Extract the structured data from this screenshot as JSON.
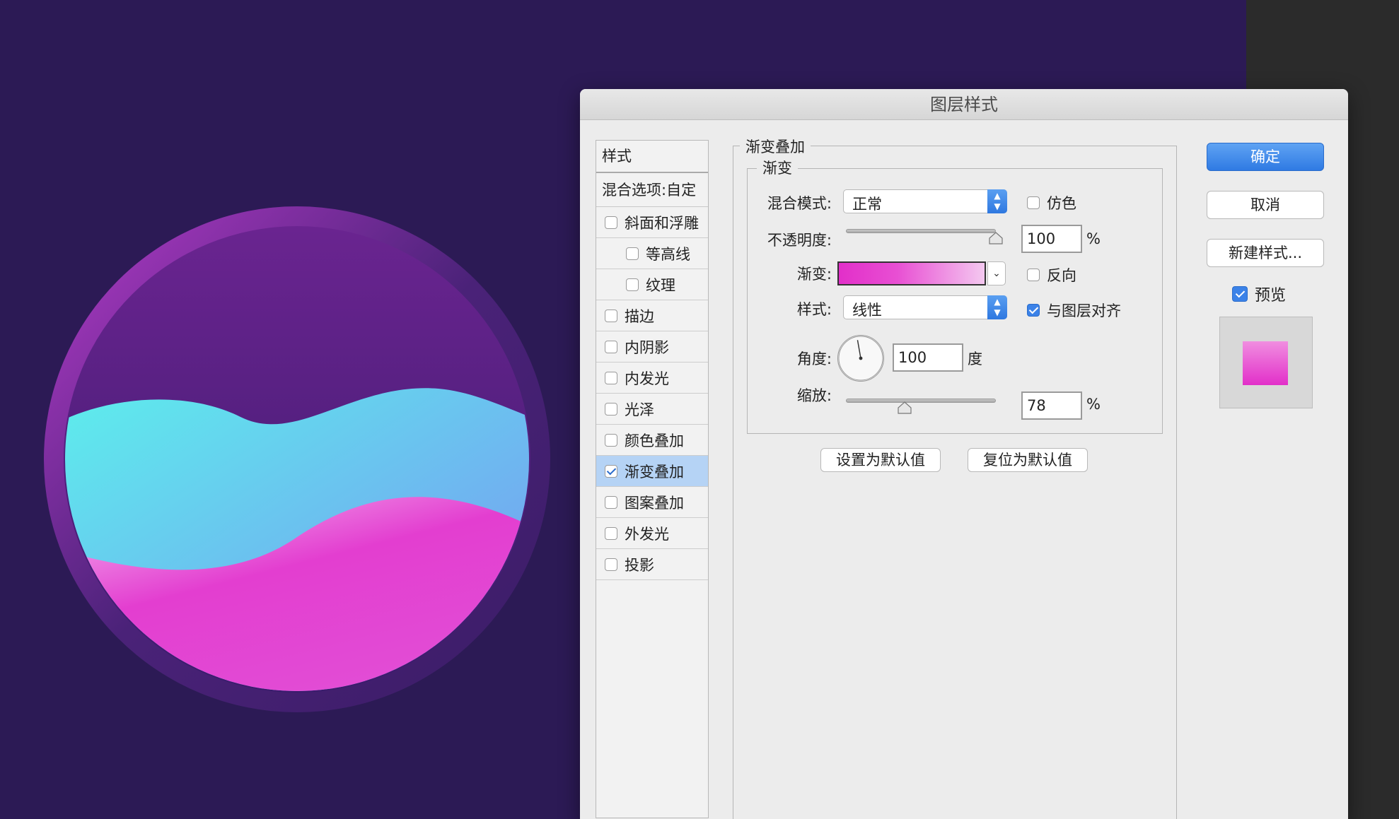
{
  "dialog": {
    "title": "图层样式",
    "ok_label": "确定",
    "cancel_label": "取消",
    "new_style_label": "新建样式...",
    "preview_label": "预览",
    "preview_checked": true
  },
  "styles_list": {
    "header": "样式",
    "blend_options": "混合选项:自定",
    "items": [
      {
        "label": "斜面和浮雕",
        "checked": false,
        "indent": false
      },
      {
        "label": "等高线",
        "checked": false,
        "indent": true
      },
      {
        "label": "纹理",
        "checked": false,
        "indent": true
      },
      {
        "label": "描边",
        "checked": false,
        "indent": false
      },
      {
        "label": "内阴影",
        "checked": false,
        "indent": false
      },
      {
        "label": "内发光",
        "checked": false,
        "indent": false
      },
      {
        "label": "光泽",
        "checked": false,
        "indent": false
      },
      {
        "label": "颜色叠加",
        "checked": false,
        "indent": false
      },
      {
        "label": "渐变叠加",
        "checked": true,
        "indent": false,
        "active": true
      },
      {
        "label": "图案叠加",
        "checked": false,
        "indent": false
      },
      {
        "label": "外发光",
        "checked": false,
        "indent": false
      },
      {
        "label": "投影",
        "checked": false,
        "indent": false
      }
    ]
  },
  "gradient_overlay": {
    "section_title": "渐变叠加",
    "group_title": "渐变",
    "blend_mode_label": "混合模式:",
    "blend_mode_value": "正常",
    "dither_label": "仿色",
    "dither_checked": false,
    "opacity_label": "不透明度:",
    "opacity_value": "100",
    "opacity_unit": "%",
    "opacity_fraction": 1.0,
    "gradient_label": "渐变:",
    "reverse_label": "反向",
    "reverse_checked": false,
    "style_label": "样式:",
    "style_value": "线性",
    "align_label": "与图层对齐",
    "align_checked": true,
    "angle_label": "角度:",
    "angle_value": "100",
    "angle_unit": "度",
    "scale_label": "缩放:",
    "scale_value": "78",
    "scale_unit": "%",
    "scale_fraction": 0.78,
    "make_default_label": "设置为默认值",
    "reset_default_label": "复位为默认值"
  },
  "colors": {
    "canvas_bg": "#2c1a55",
    "accent_blue": "#3b82e8",
    "gradient_start": "#e22fc9",
    "gradient_end": "#f4c8f0"
  }
}
